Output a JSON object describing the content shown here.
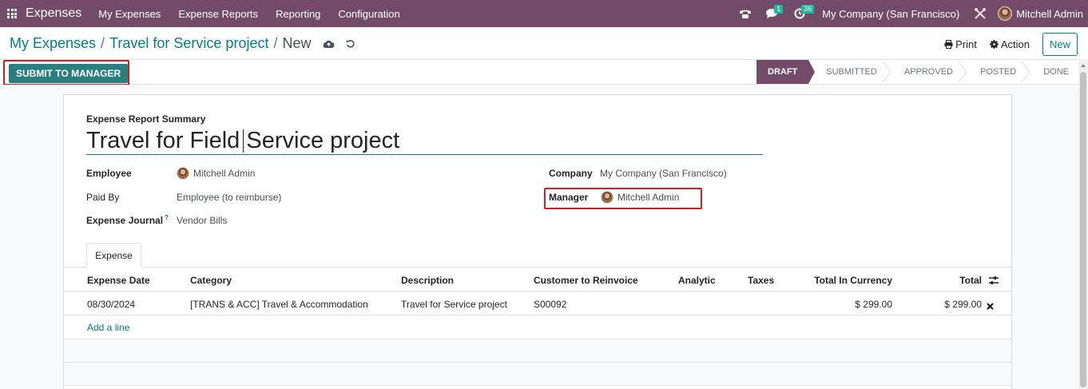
{
  "navbar": {
    "app_name": "Expenses",
    "menu": [
      "My Expenses",
      "Expense Reports",
      "Reporting",
      "Configuration"
    ],
    "chat_badge": "1",
    "activity_badge": "36",
    "company": "My Company (San Francisco)",
    "user": "Mitchell Admin"
  },
  "breadcrumb": {
    "parent1": "My Expenses",
    "parent2": "Travel for Service project",
    "current": "New",
    "separator": "/"
  },
  "control_panel": {
    "print_label": "Print",
    "action_label": "Action",
    "new_label": "New"
  },
  "statusbar": {
    "submit_label": "SUBMIT TO MANAGER",
    "stages": [
      "DRAFT",
      "SUBMITTED",
      "APPROVED",
      "POSTED",
      "DONE"
    ],
    "active_stage": "DRAFT"
  },
  "form": {
    "summary_label": "Expense Report Summary",
    "title": "Travel for Field Service project",
    "employee_label": "Employee",
    "employee_value": "Mitchell Admin",
    "paid_by_label": "Paid By",
    "paid_by_value": "Employee (to reimburse)",
    "journal_label": "Expense Journal",
    "journal_help": "?",
    "journal_value": "Vendor Bills",
    "company_label": "Company",
    "company_value": "My Company (San Francisco)",
    "manager_label": "Manager",
    "manager_value": "Mitchell Admin"
  },
  "notebook": {
    "tab_label": "Expense"
  },
  "table": {
    "headers": [
      "Expense Date",
      "Category",
      "Description",
      "Customer to Reinvoice",
      "Analytic",
      "Taxes",
      "Total In Currency",
      "Total"
    ],
    "rows": [
      {
        "date": "08/30/2024",
        "category": "[TRANS & ACC] Travel & Accommodation",
        "description": "Travel for Service project",
        "customer": "S00092",
        "analytic": "",
        "taxes": "",
        "total_currency": "$ 299.00",
        "total": "$ 299.00"
      }
    ],
    "add_line_label": "Add a line"
  },
  "colors": {
    "navbar": "#714b67",
    "link": "#017e84",
    "primary_button": "#2a7e80",
    "highlight": "#cc1f1f"
  }
}
